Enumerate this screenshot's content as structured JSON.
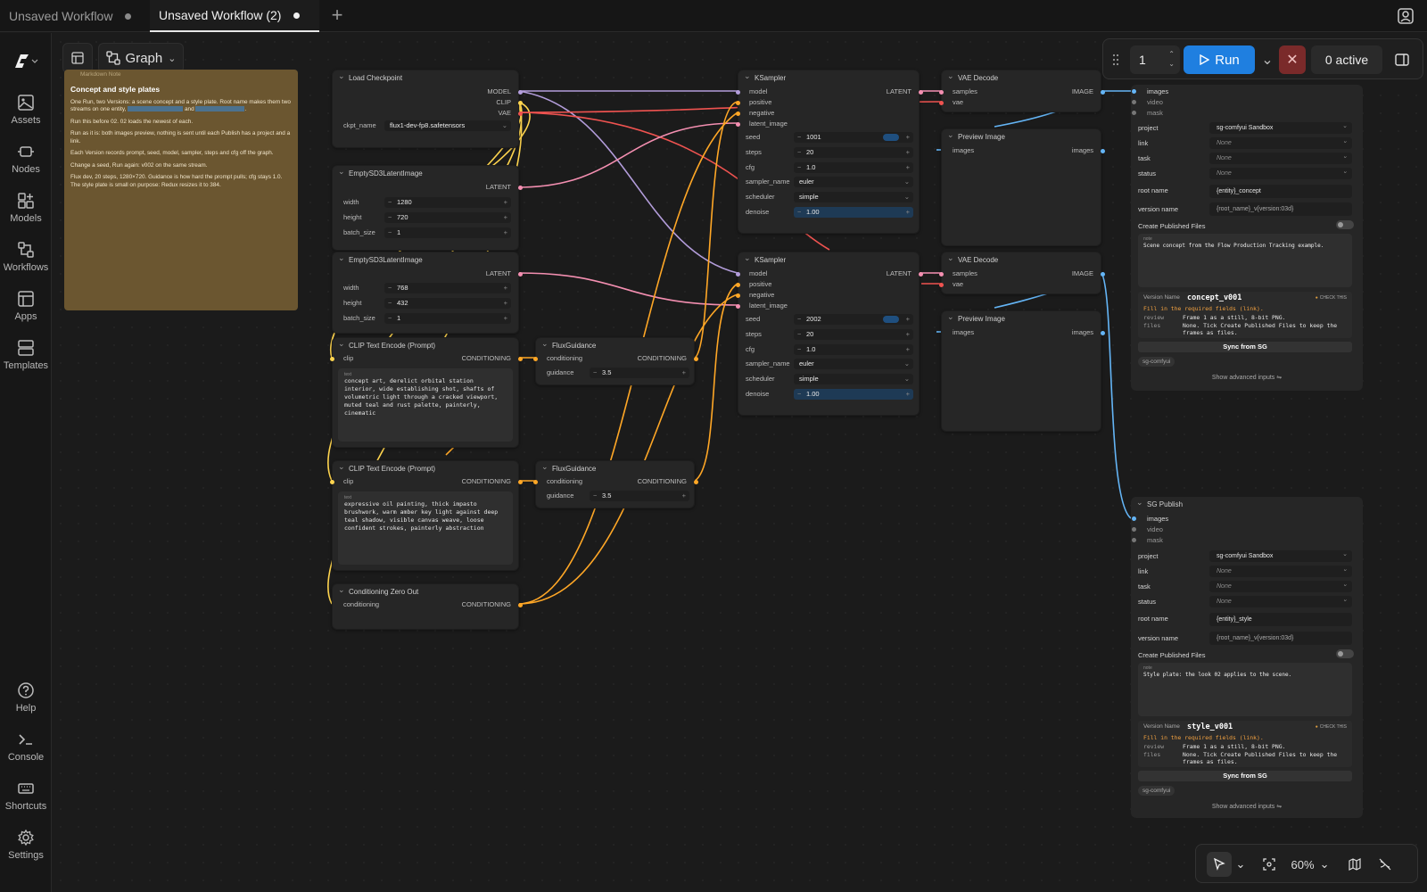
{
  "tabs": [
    {
      "label": "Unsaved Workflow",
      "active": false
    },
    {
      "label": "Unsaved Workflow (2)",
      "active": true
    }
  ],
  "sidebar": {
    "items": [
      {
        "label": "Assets",
        "icon": "image-icon"
      },
      {
        "label": "Nodes",
        "icon": "nodes-icon"
      },
      {
        "label": "Models",
        "icon": "models-icon"
      },
      {
        "label": "Workflows",
        "icon": "workflows-icon"
      },
      {
        "label": "Apps",
        "icon": "apps-icon"
      },
      {
        "label": "Templates",
        "icon": "templates-icon"
      },
      {
        "label": "Help",
        "icon": "help-icon"
      },
      {
        "label": "Console",
        "icon": "console-icon"
      },
      {
        "label": "Shortcuts",
        "icon": "keyboard-icon"
      },
      {
        "label": "Settings",
        "icon": "gear-icon"
      }
    ]
  },
  "toolbar": {
    "view_label": "Graph"
  },
  "runbar": {
    "queue_count": "1",
    "run_label": "Run",
    "active_label": "0 active"
  },
  "zoom": {
    "level": "60%"
  },
  "note": {
    "header": "Markdown Note",
    "title": "Concept and style plates",
    "p1a": "One Run, two Versions: a scene concept and a style plate. Root name makes them two streams on one entity,",
    "p1b": "and",
    "p2": "Run this before 02. 02 loads the newest of each.",
    "p3": "Run as it is: both images preview, nothing is sent until each Publish has a project and a link.",
    "p4": "Each Version records prompt, seed, model, sampler, steps and cfg off the graph.",
    "p5": "Change a seed, Run again: v002 on the same stream.",
    "p6": "Flux dev, 20 steps, 1280×720. Guidance is how hard the prompt pulls; cfg stays 1.0. The style plate is small on purpose: Redux resizes it to 384."
  },
  "load_checkpoint": {
    "title": "Load Checkpoint",
    "out_model": "MODEL",
    "out_clip": "CLIP",
    "out_vae": "VAE",
    "ckpt_label": "ckpt_name",
    "ckpt_value": "flux1-dev-fp8.safetensors"
  },
  "latent1": {
    "title": "EmptySD3LatentImage",
    "out": "LATENT",
    "width_label": "width",
    "width": "1280",
    "height_label": "height",
    "height": "720",
    "batch_label": "batch_size",
    "batch": "1"
  },
  "latent2": {
    "title": "EmptySD3LatentImage",
    "out": "LATENT",
    "width_label": "width",
    "width": "768",
    "height_label": "height",
    "height": "432",
    "batch_label": "batch_size",
    "batch": "1"
  },
  "clip1": {
    "title": "CLIP Text Encode (Prompt)",
    "in": "clip",
    "out": "CONDITIONING",
    "text_label": "text",
    "text": "concept art, derelict orbital station interior, wide establishing shot, shafts of volumetric light through a cracked viewport, muted teal and rust palette, painterly, cinematic"
  },
  "clip2": {
    "title": "CLIP Text Encode (Prompt)",
    "in": "clip",
    "out": "CONDITIONING",
    "text_label": "text",
    "text": "expressive oil painting, thick impasto brushwork, warm amber key light against deep teal shadow, visible canvas weave, loose confident strokes, painterly abstraction"
  },
  "zero_out": {
    "title": "Conditioning Zero Out",
    "in": "conditioning",
    "out": "CONDITIONING"
  },
  "flux1": {
    "title": "FluxGuidance",
    "in": "conditioning",
    "out": "CONDITIONING",
    "guidance_label": "guidance",
    "guidance": "3.5"
  },
  "flux2": {
    "title": "FluxGuidance",
    "in": "conditioning",
    "out": "CONDITIONING",
    "guidance_label": "guidance",
    "guidance": "3.5"
  },
  "ksampler1": {
    "title": "KSampler",
    "in_model": "model",
    "in_positive": "positive",
    "in_negative": "negative",
    "in_latent": "latent_image",
    "out": "LATENT",
    "seed_label": "seed",
    "seed": "1001",
    "steps_label": "steps",
    "steps": "20",
    "cfg_label": "cfg",
    "cfg": "1.0",
    "sampler_label": "sampler_name",
    "sampler": "euler",
    "scheduler_label": "scheduler",
    "scheduler": "simple",
    "denoise_label": "denoise",
    "denoise": "1.00"
  },
  "ksampler2": {
    "title": "KSampler",
    "in_model": "model",
    "in_positive": "positive",
    "in_negative": "negative",
    "in_latent": "latent_image",
    "out": "LATENT",
    "seed_label": "seed",
    "seed": "2002",
    "steps_label": "steps",
    "steps": "20",
    "cfg_label": "cfg",
    "cfg": "1.0",
    "sampler_label": "sampler_name",
    "sampler": "euler",
    "scheduler_label": "scheduler",
    "scheduler": "simple",
    "denoise_label": "denoise",
    "denoise": "1.00"
  },
  "vae1": {
    "title": "VAE Decode",
    "in_samples": "samples",
    "in_vae": "vae",
    "out": "IMAGE"
  },
  "vae2": {
    "title": "VAE Decode",
    "in_samples": "samples",
    "in_vae": "vae",
    "out": "IMAGE"
  },
  "preview1": {
    "title": "Preview Image",
    "in": "images",
    "out": "images"
  },
  "preview2": {
    "title": "Preview Image",
    "in": "images",
    "out": "images"
  },
  "sg1": {
    "in_images": "images",
    "in_video": "video",
    "in_mask": "mask",
    "project_label": "project",
    "project": "sg-comfyui Sandbox",
    "link_label": "link",
    "link": "None",
    "task_label": "task",
    "task": "None",
    "status_label": "status",
    "status": "None",
    "root_label": "root name",
    "root": "{entity}_concept",
    "version_label": "version name",
    "version": "{root_name}_v{version:03d}",
    "publish_label": "Create Published Files",
    "note_label": "note",
    "note": "Scene concept from the Flow Production Tracking example.",
    "vn_label": "Version Name",
    "vn": "concept_v001",
    "check": "CHECK THIS",
    "warn": "Fill in the required fields (link).",
    "review_label": "review",
    "review": "Frame 1 as a still, 8-bit PNG.",
    "files_label": "files",
    "files": "None. Tick Create Published Files to keep the frames as files.",
    "sync": "Sync from SG",
    "tag": "sg-comfyui",
    "advanced": "Show advanced inputs"
  },
  "sg2": {
    "title": "SG Publish",
    "in_images": "images",
    "in_video": "video",
    "in_mask": "mask",
    "project_label": "project",
    "project": "sg-comfyui Sandbox",
    "link_label": "link",
    "link": "None",
    "task_label": "task",
    "task": "None",
    "status_label": "status",
    "status": "None",
    "root_label": "root name",
    "root": "{entity}_style",
    "version_label": "version name",
    "version": "{root_name}_v{version:03d}",
    "publish_label": "Create Published Files",
    "note_label": "note",
    "note": "Style plate: the look 02 applies to the scene.",
    "vn_label": "Version Name",
    "vn": "style_v001",
    "check": "CHECK THIS",
    "warn": "Fill in the required fields (link).",
    "review_label": "review",
    "review": "Frame 1 as a still, 8-bit PNG.",
    "files_label": "files",
    "files": "None. Tick Create Published Files to keep the frames as files.",
    "sync": "Sync from SG",
    "tag": "sg-comfyui",
    "advanced": "Show advanced inputs"
  },
  "colors": {
    "model": "#b39ddb",
    "clip": "#ffd54f",
    "vae": "#ef5350",
    "latent": "#f48fb1",
    "conditioning": "#ffa726",
    "image": "#64b5f6",
    "run": "#1f7fe0",
    "note_bg": "#6b5630"
  }
}
